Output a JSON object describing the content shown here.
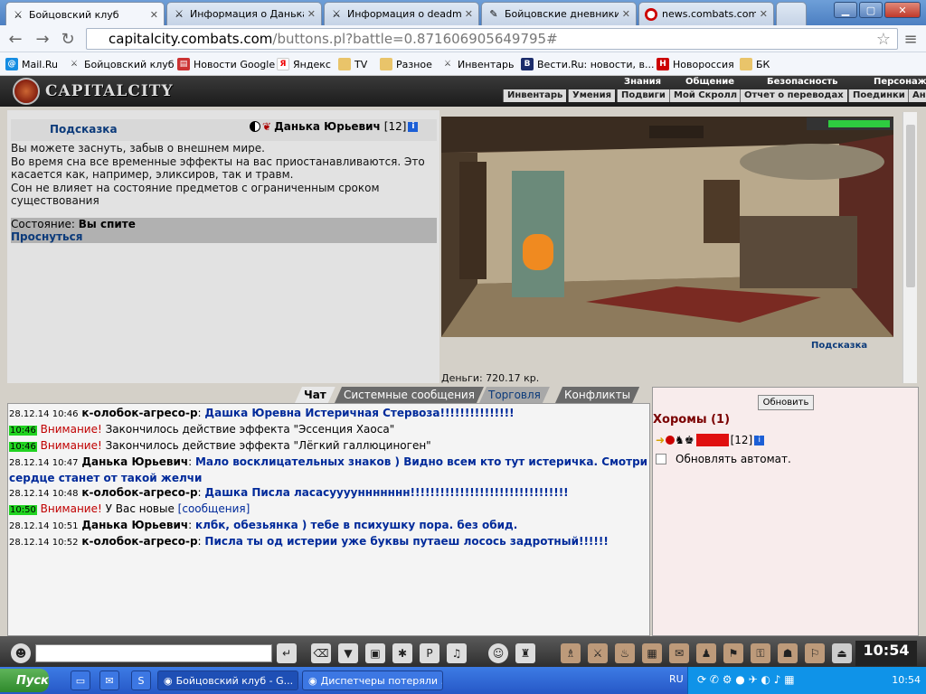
{
  "browser": {
    "tabs": [
      {
        "label": "Бойцовский клуб",
        "active": true
      },
      {
        "label": "Информация о Данька Ю",
        "active": false
      },
      {
        "label": "Информация о deadman",
        "active": false
      },
      {
        "label": "Бойцовские дневники -",
        "active": false
      },
      {
        "label": "news.combats.com",
        "active": false
      }
    ],
    "url_host": "capitalcity.combats.com",
    "url_path": "/buttons.pl?battle=0.871606905649795#",
    "bookmarks": [
      "Mail.Ru",
      "Бойцовский клуб",
      "Новости Google",
      "Яндекс",
      "TV",
      "Разное",
      "Инвентарь",
      "Вести.Ru: новости, в...",
      "Новороссия",
      "БК"
    ]
  },
  "game": {
    "logo": "CAPITALCITY",
    "menu_top": [
      "Знания",
      "Общение",
      "Безопасность",
      "Персонаж"
    ],
    "menu_bottom": [
      "Инвентарь",
      "Умения",
      "Подвиги",
      "Мой Скролл",
      "Отчет о переводах",
      "Поединки",
      "Ан"
    ],
    "tip_link": "Подсказка",
    "character": {
      "name": "Данька Юрьевич",
      "level": "[12]"
    },
    "description": [
      "Вы можете заснуть, забыв о внешнем мире.",
      "Во время сна все временные эффекты на вас приостанавливаются. Это касается как, например, эликсиров, так и травм.",
      "Сон не влияет на состояние предметов с ограниченным сроком существования"
    ],
    "state_label": "Состояние:",
    "state_value": "Вы спите",
    "wake_link": "Проснуться",
    "hint2": "Подсказка",
    "money": "Деньги: 720.17 кр."
  },
  "chat": {
    "tabs": [
      "Чат",
      "Системные сообщения",
      "Торговля",
      "Конфликты"
    ],
    "lines": [
      {
        "time": "28.12.14 10:46",
        "nick": "к-олобок-агресо-р",
        "text": "Дашка Юревна Истеричная Стервоза!!!!!!!!!!!!!!!"
      },
      {
        "time": "10:46",
        "warn": "Внимание!",
        "sys": "Закончилось действие эффекта \"Эссенция Хаоса\""
      },
      {
        "time": "10:46",
        "warn": "Внимание!",
        "sys": "Закончилось действие эффекта \"Лёгкий галлюциноген\""
      },
      {
        "time": "28.12.14 10:47",
        "nick": "Данька Юрьевич",
        "text": "Мало восклицательных знаков ) Видно всем кто тут истеричка. Смотри сердце станет от такой желчи"
      },
      {
        "time": "28.12.14 10:48",
        "nick": "к-олобок-агресо-р",
        "text": "Дашка Писла ласасууууннннннн!!!!!!!!!!!!!!!!!!!!!!!!!!!!!!!!"
      },
      {
        "time": "10:50",
        "warn": "Внимание!",
        "sys": "У Вас новые ",
        "link": "[сообщения]"
      },
      {
        "time": "28.12.14 10:51",
        "nick": "Данька Юрьевич",
        "text": "клбк, обезьянка ) тебе в психушку пора. без обид."
      },
      {
        "time": "28.12.14 10:52",
        "nick": "к-олобок-агресо-р",
        "text": "Писла ты од истерии уже буквы путаеш лосось задротный!!!!!!"
      }
    ]
  },
  "room": {
    "refresh": "Обновить",
    "title": "Хоромы (1)",
    "user_level": "[12]",
    "auto_update": "Обновлять автомат."
  },
  "toolbar": {
    "clock": "10:54"
  },
  "taskbar": {
    "start": "Пуск",
    "tasks": [
      "Бойцовский клуб - G...",
      "Диспетчеры потеряли ..."
    ],
    "lang": "RU",
    "time": "10:54"
  },
  "colors": {
    "accent": "#0b3a7a",
    "warn": "#c00000",
    "chatmsg": "#002a9a",
    "roomtitle": "#7a0000"
  }
}
